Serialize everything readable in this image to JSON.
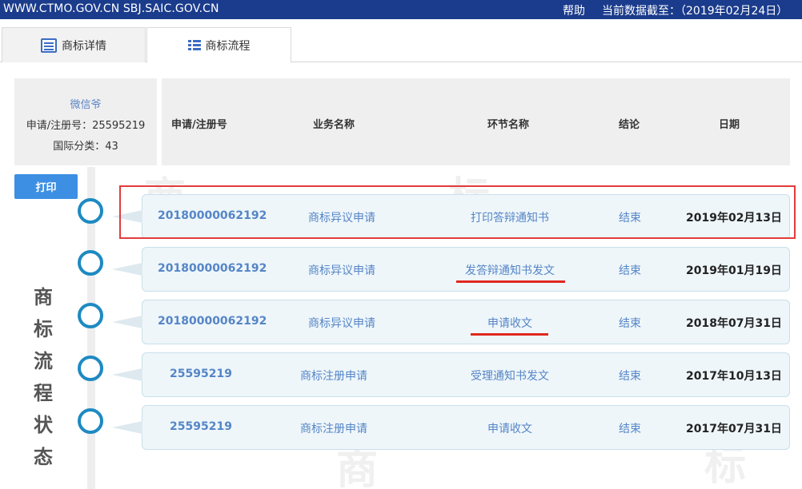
{
  "topbar": {
    "sites": "WWW.CTMO.GOV.CN SBJ.SAIC.GOV.CN",
    "help": "帮助",
    "updated": "当前数据截至：（2019年02月24日）"
  },
  "tabs": [
    {
      "label": "商标详情",
      "icon": "detail-icon",
      "active": false
    },
    {
      "label": "商标流程",
      "icon": "list-icon",
      "active": true
    }
  ],
  "info": {
    "wechat": "微信爷",
    "reg_no": "申请/注册号：25595219",
    "class": "国际分类：43"
  },
  "columns": [
    "申请/注册号",
    "业务名称",
    "环节名称",
    "结论",
    "日期"
  ],
  "print_label": "打印",
  "vertical_title": [
    "商",
    "标",
    "流",
    "程",
    "状",
    "态"
  ],
  "rows": [
    {
      "no": "20180000062192",
      "business": "商标异议申请",
      "step": "打印答辩通知书",
      "result": "结束",
      "date": "2019年02月13日"
    },
    {
      "no": "20180000062192",
      "business": "商标异议申请",
      "step": "发答辩通知书发文",
      "result": "结束",
      "date": "2019年01月19日"
    },
    {
      "no": "20180000062192",
      "business": "商标异议申请",
      "step": "申请收文",
      "result": "结束",
      "date": "2018年07月31日"
    },
    {
      "no": "25595219",
      "business": "商标注册申请",
      "step": "受理通知书发文",
      "result": "结束",
      "date": "2017年10月13日"
    },
    {
      "no": "25595219",
      "business": "商标注册申请",
      "step": "申请收文",
      "result": "结束",
      "date": "2017年07月31日"
    }
  ],
  "colors": {
    "topbar": "#1b3c8c",
    "accent": "#3d8fe3",
    "timeline_node": "#1d8ac2",
    "highlight": "#e23b3b"
  }
}
